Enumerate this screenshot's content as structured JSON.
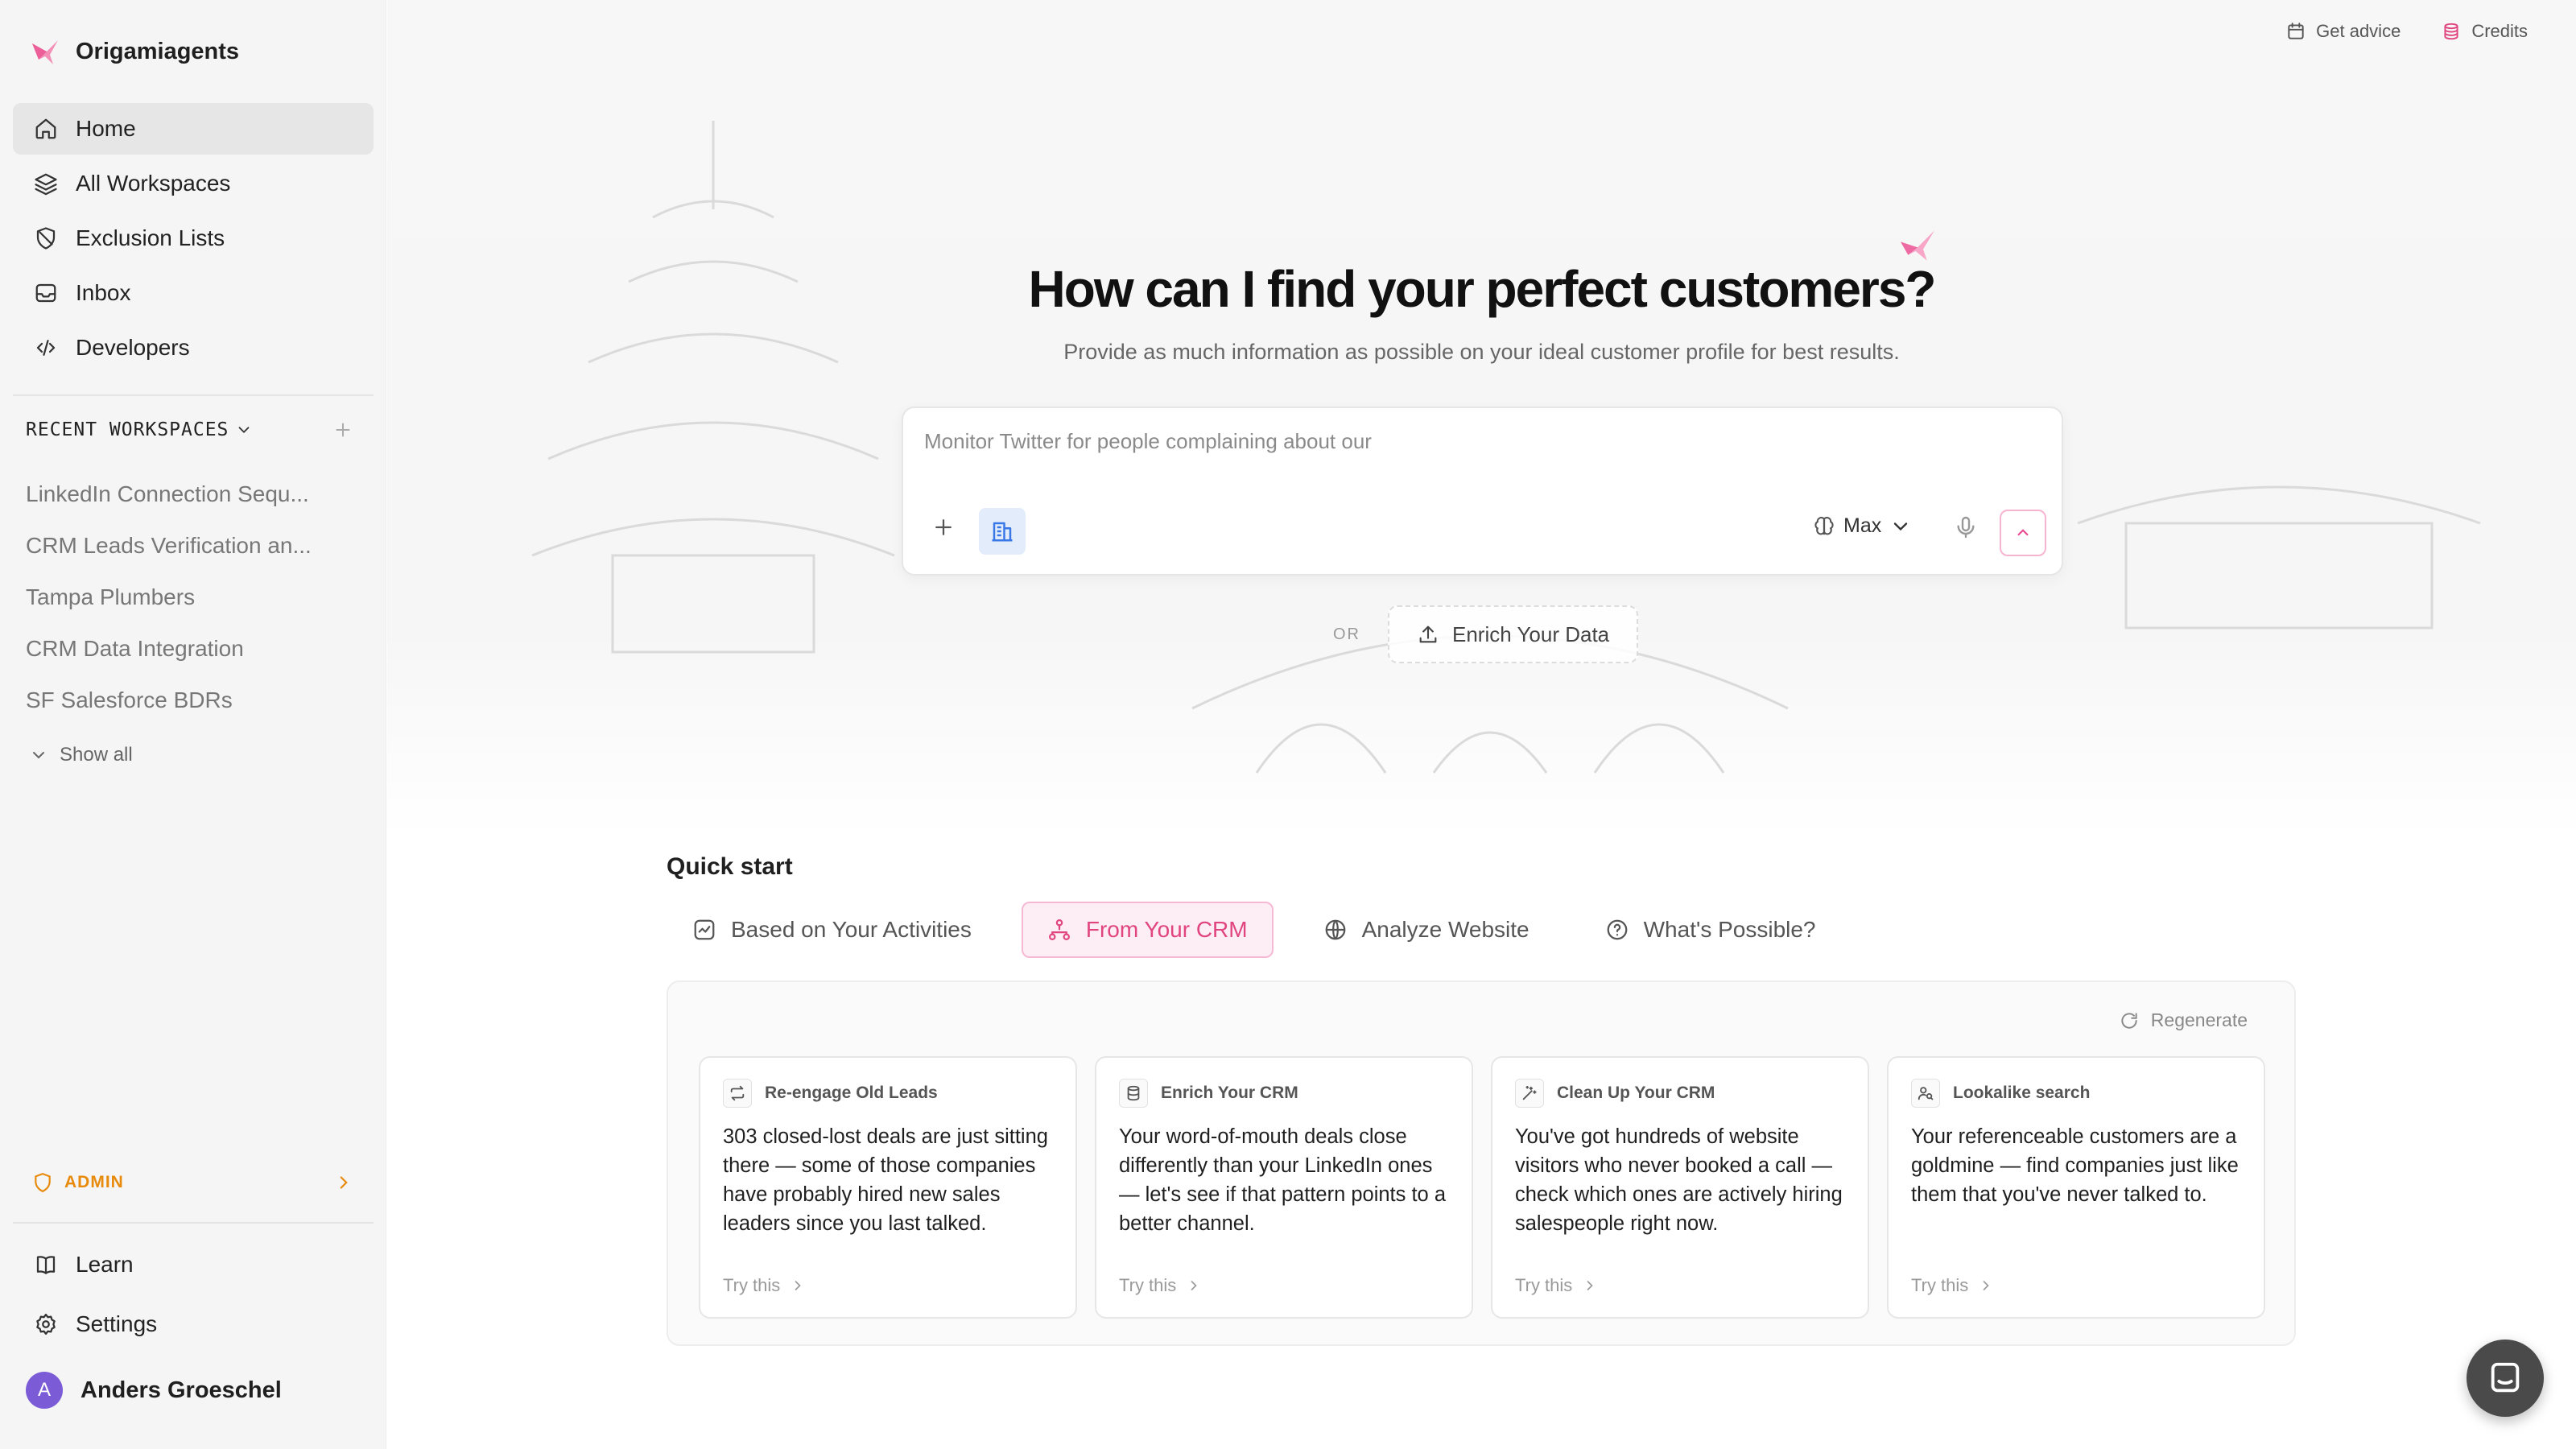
{
  "brand": {
    "name": "Origamiagents"
  },
  "nav": [
    {
      "label": "Home",
      "icon": "home-icon",
      "active": true
    },
    {
      "label": "All Workspaces",
      "icon": "layers-icon"
    },
    {
      "label": "Exclusion Lists",
      "icon": "shield-off-icon"
    },
    {
      "label": "Inbox",
      "icon": "inbox-icon"
    },
    {
      "label": "Developers",
      "icon": "code-icon"
    }
  ],
  "recent": {
    "title": "RECENT WORKSPACES",
    "items": [
      "LinkedIn Connection Sequ...",
      "CRM Leads Verification an...",
      "Tampa Plumbers",
      "CRM Data Integration",
      "SF Salesforce BDRs"
    ],
    "show_all": "Show all"
  },
  "admin": {
    "label": "ADMIN"
  },
  "bottom_nav": [
    {
      "label": "Learn",
      "icon": "book-icon"
    },
    {
      "label": "Settings",
      "icon": "gear-icon"
    }
  ],
  "user": {
    "initial": "A",
    "name": "Anders Groeschel"
  },
  "top_links": {
    "advice": "Get advice",
    "credits": "Credits"
  },
  "hero": {
    "title": "How can I find your perfect customers?",
    "subtitle": "Provide as much information as possible on your ideal customer profile for best results."
  },
  "prompt": {
    "placeholder": "Monitor Twitter for people complaining about our",
    "model": "Max"
  },
  "or_label": "OR",
  "enrich_label": "Enrich Your Data",
  "quick_start": {
    "title": "Quick start",
    "tabs": [
      {
        "label": "Based on Your Activities",
        "icon": "activity-icon"
      },
      {
        "label": "From Your CRM",
        "icon": "hierarchy-icon",
        "active": true
      },
      {
        "label": "Analyze Website",
        "icon": "globe-icon"
      },
      {
        "label": "What's Possible?",
        "icon": "help-circle-icon"
      }
    ],
    "regenerate": "Regenerate",
    "cards": [
      {
        "title": "Re-engage Old Leads",
        "icon": "repeat-icon",
        "body": "303 closed-lost deals are just sitting there — some of those companies have probably hired new sales leaders since you last talked.",
        "cta": "Try this"
      },
      {
        "title": "Enrich Your CRM",
        "icon": "database-icon",
        "body": "Your word-of-mouth deals close differently than your LinkedIn ones — let's see if that pattern points to a better channel.",
        "cta": "Try this"
      },
      {
        "title": "Clean Up Your CRM",
        "icon": "wand-icon",
        "body": "You've got hundreds of website visitors who never booked a call — check which ones are actively hiring salespeople right now.",
        "cta": "Try this"
      },
      {
        "title": "Lookalike search",
        "icon": "users-search-icon",
        "body": "Your referenceable customers are a goldmine — find companies just like them that you've never talked to.",
        "cta": "Try this"
      }
    ]
  },
  "colors": {
    "accent": "#e0457f",
    "admin": "#e88a0c",
    "avatar": "#7b5cd6"
  }
}
